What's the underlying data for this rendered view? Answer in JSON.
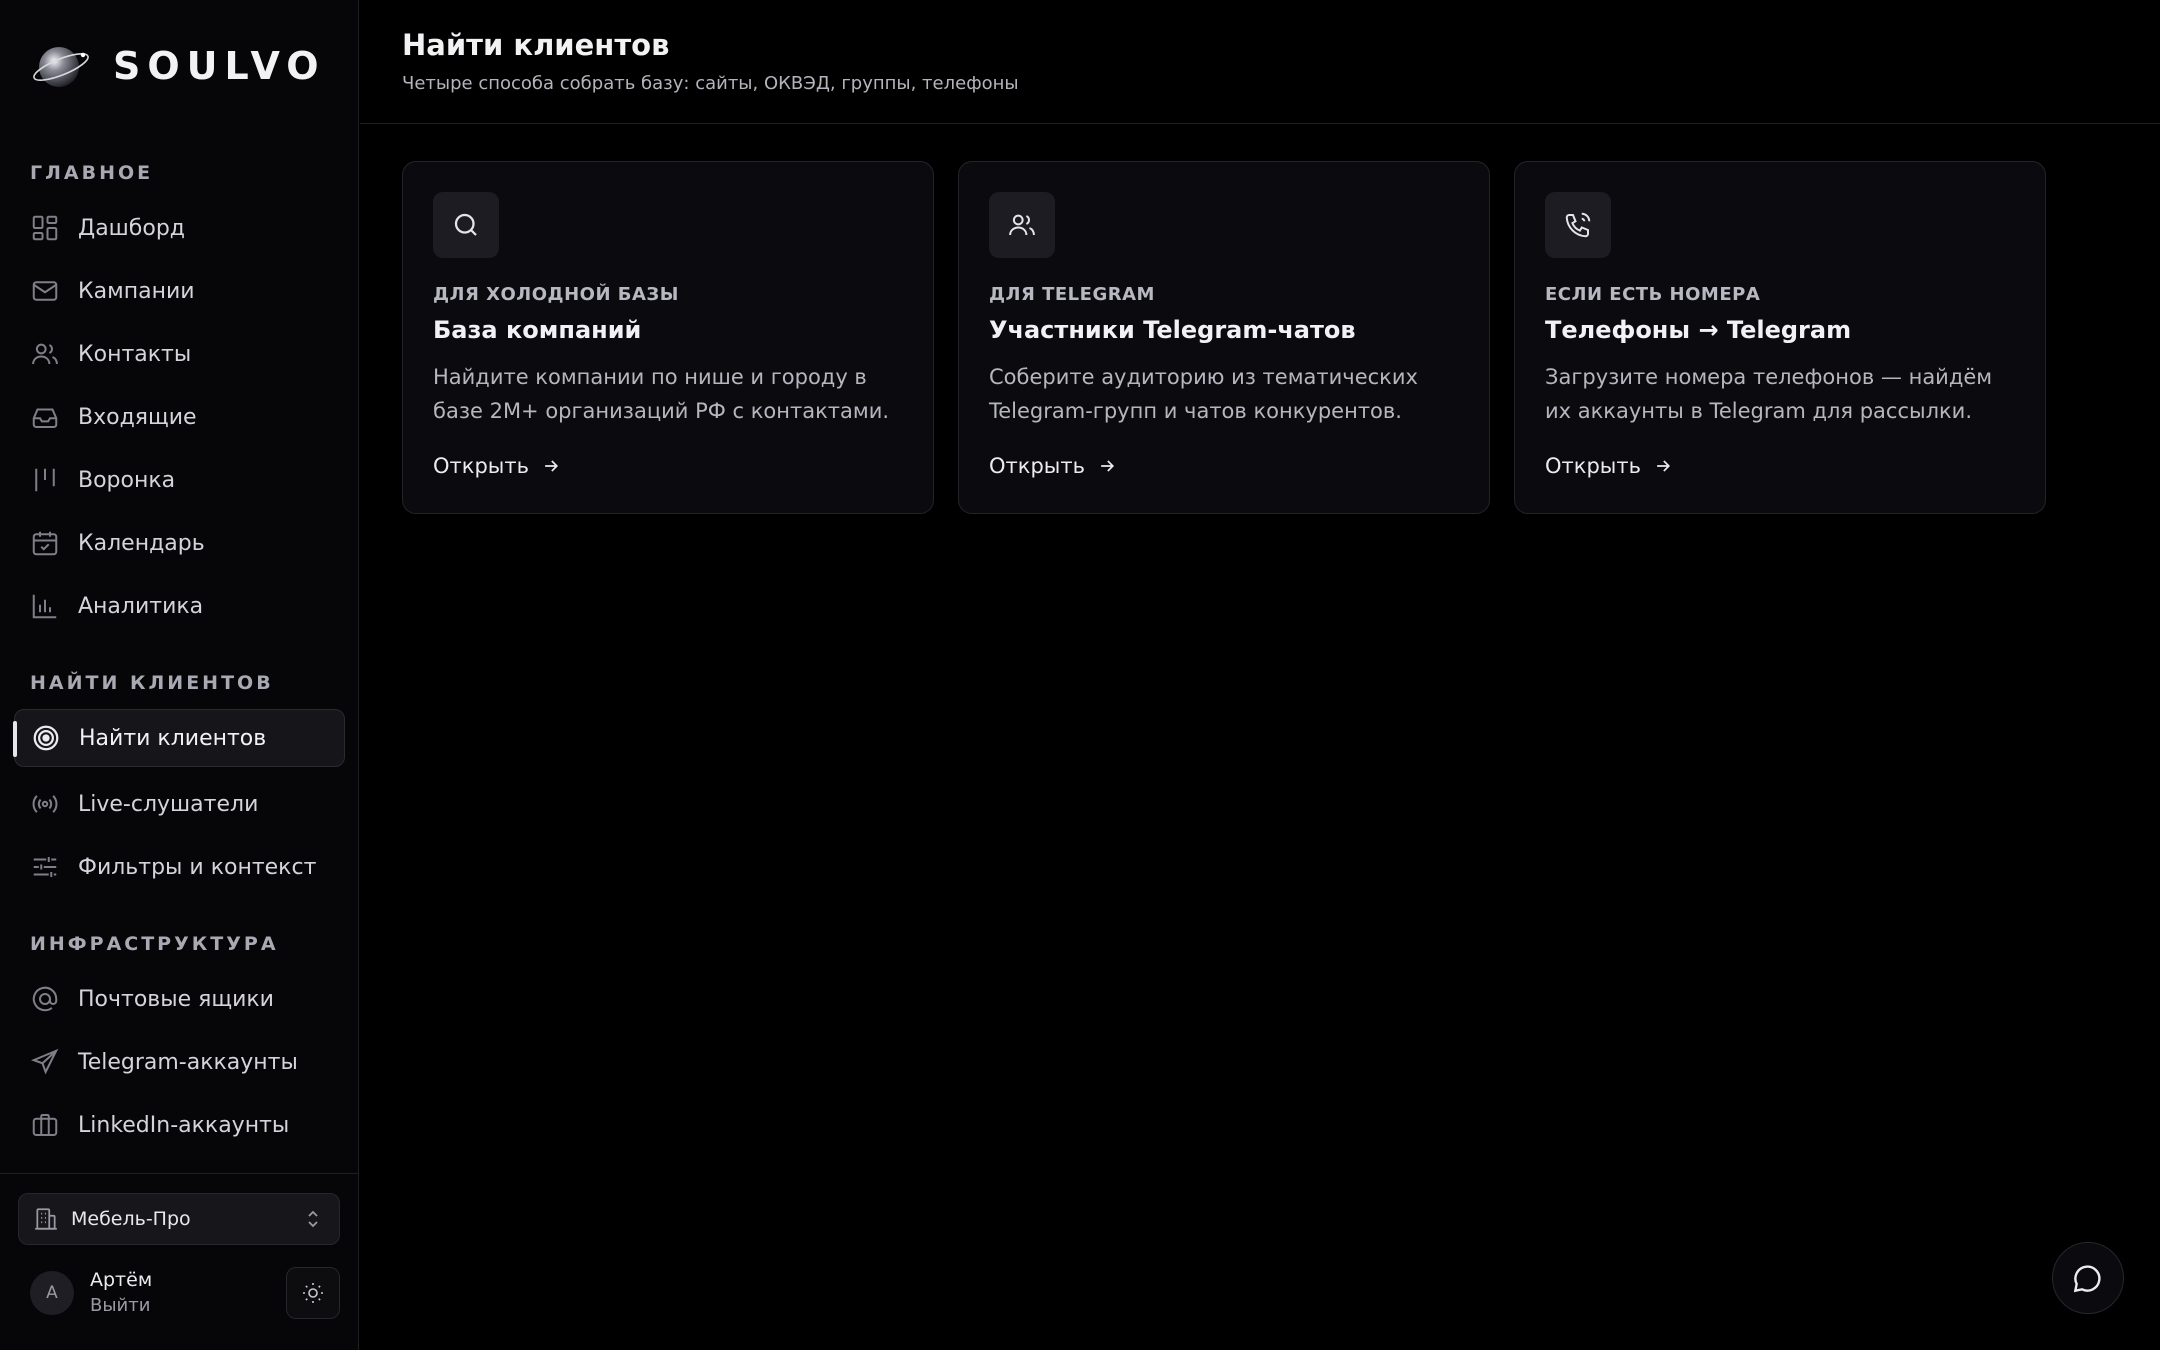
{
  "brand": {
    "name": "SOULVO"
  },
  "sidebar": {
    "sections": [
      {
        "label": "ГЛАВНОЕ"
      },
      {
        "label": "НАЙТИ КЛИЕНТОВ"
      },
      {
        "label": "ИНФРАСТРУКТУРА"
      }
    ],
    "items": [
      {
        "label": "Дашборд",
        "icon": "dashboard-icon"
      },
      {
        "label": "Кампании",
        "icon": "mail-icon"
      },
      {
        "label": "Контакты",
        "icon": "users-icon"
      },
      {
        "label": "Входящие",
        "icon": "inbox-icon"
      },
      {
        "label": "Воронка",
        "icon": "funnel-icon"
      },
      {
        "label": "Календарь",
        "icon": "calendar-icon"
      },
      {
        "label": "Аналитика",
        "icon": "bar-chart-icon"
      },
      {
        "label": "Найти клиентов",
        "icon": "target-icon",
        "active": true
      },
      {
        "label": "Live-слушатели",
        "icon": "broadcast-icon"
      },
      {
        "label": "Фильтры и контекст",
        "icon": "sliders-icon"
      },
      {
        "label": "Почтовые ящики",
        "icon": "at-icon"
      },
      {
        "label": "Telegram-аккаунты",
        "icon": "send-icon"
      },
      {
        "label": "LinkedIn-аккаунты",
        "icon": "briefcase-icon"
      }
    ],
    "workspace": {
      "name": "Мебель-Про"
    },
    "user": {
      "initial": "А",
      "name": "Артём",
      "action": "Выйти"
    }
  },
  "header": {
    "title": "Найти клиентов",
    "subtitle": "Четыре способа собрать базу: сайты, ОКВЭД, группы, телефоны"
  },
  "cards": [
    {
      "icon": "search-icon",
      "eyebrow": "ДЛЯ ХОЛОДНОЙ БАЗЫ",
      "title": "База компаний",
      "desc": "Найдите компании по нише и городу в базе 2М+ организаций РФ с контактами.",
      "action": "Открыть"
    },
    {
      "icon": "users-icon",
      "eyebrow": "ДЛЯ TELEGRAM",
      "title": "Участники Telegram-чатов",
      "desc": "Соберите аудиторию из тематических Telegram-групп и чатов конкурентов.",
      "action": "Открыть"
    },
    {
      "icon": "phone-icon",
      "eyebrow": "ЕСЛИ ЕСТЬ НОМЕРА",
      "title": "Телефоны → Telegram",
      "desc": "Загрузите номера телефонов — найдём их аккаунты в Telegram для рассылки.",
      "action": "Открыть"
    }
  ],
  "colors": {
    "background": "#000000",
    "sidebar": "#060608",
    "card": "#0b0b0f",
    "accent": "#ececf0"
  }
}
